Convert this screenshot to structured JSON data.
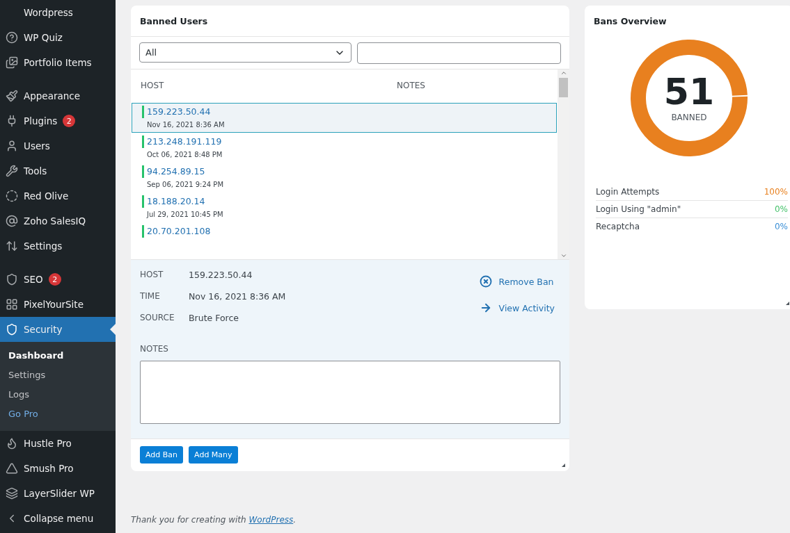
{
  "sidebar": {
    "groups": [
      [
        {
          "label": "Wordpress",
          "selected": false
        },
        {
          "label": "WP Quiz",
          "selected": false
        },
        {
          "label": "Portfolio Items",
          "selected": false
        }
      ],
      [
        {
          "label": "Appearance",
          "selected": false
        },
        {
          "label": "Plugins",
          "selected": false,
          "badge": "2"
        },
        {
          "label": "Users",
          "selected": false
        },
        {
          "label": "Tools",
          "selected": false
        },
        {
          "label": "Red Olive",
          "selected": false
        },
        {
          "label": "Zoho SalesIQ",
          "selected": false
        },
        {
          "label": "Settings",
          "selected": false
        }
      ],
      [
        {
          "label": "SEO",
          "selected": false,
          "badge": "2"
        },
        {
          "label": "PixelYourSite",
          "selected": false
        },
        {
          "label": "Security",
          "selected": true,
          "children": [
            {
              "label": "Dashboard",
              "selected": true
            },
            {
              "label": "Settings",
              "selected": false
            },
            {
              "label": "Logs",
              "selected": false
            },
            {
              "label": "Go Pro",
              "selected": false,
              "color": "#72aee6"
            }
          ]
        },
        {
          "label": "Hustle Pro",
          "selected": false
        },
        {
          "label": "Smush Pro",
          "selected": false
        },
        {
          "label": "LayerSlider WP",
          "selected": false
        },
        {
          "label": "Collapse menu",
          "selected": false
        }
      ]
    ]
  },
  "banned_users": {
    "title": "Banned Users",
    "filter": {
      "value": "All"
    },
    "columns": [
      "HOST",
      "NOTES"
    ],
    "rows": [
      {
        "host": "159.223.50.44",
        "date": "Nov 16, 2021 8:36 AM",
        "selected": true
      },
      {
        "host": "213.248.191.119",
        "date": "Oct 06, 2021 8:48 PM",
        "selected": false
      },
      {
        "host": "94.254.89.15",
        "date": "Sep 06, 2021 9:24 PM",
        "selected": false
      },
      {
        "host": "18.188.20.14",
        "date": "Jul 29, 2021 10:45 PM",
        "selected": false
      },
      {
        "host": "20.70.201.108",
        "selected": false
      }
    ],
    "details": [
      {
        "label": "HOST",
        "value": "159.223.50.44"
      },
      {
        "label": "TIME",
        "value": "Nov 16, 2021 8:36 AM"
      },
      {
        "label": "SOURCE",
        "value": "Brute Force"
      }
    ],
    "actions": [
      {
        "kind": "remove",
        "label": "Remove Ban"
      },
      {
        "kind": "activity",
        "label": "View Activity"
      }
    ],
    "notes_label": "NOTES",
    "buttons": [
      "Add Ban",
      "Add Many"
    ]
  },
  "bans_overview": {
    "title": "Bans Overview",
    "count": "51",
    "count_label": "BANNED",
    "stats": [
      {
        "label": "Login Attempts",
        "value": "100%",
        "color": "#e8801f"
      },
      {
        "label": "Login Using \"admin\"",
        "value": "0%",
        "color": "#46c26b"
      },
      {
        "label": "Recaptcha",
        "value": "0%",
        "color": "#3a8fd6"
      }
    ]
  },
  "footer": {
    "text": "Thank you for creating with ",
    "link": "WordPress",
    "after": "."
  }
}
